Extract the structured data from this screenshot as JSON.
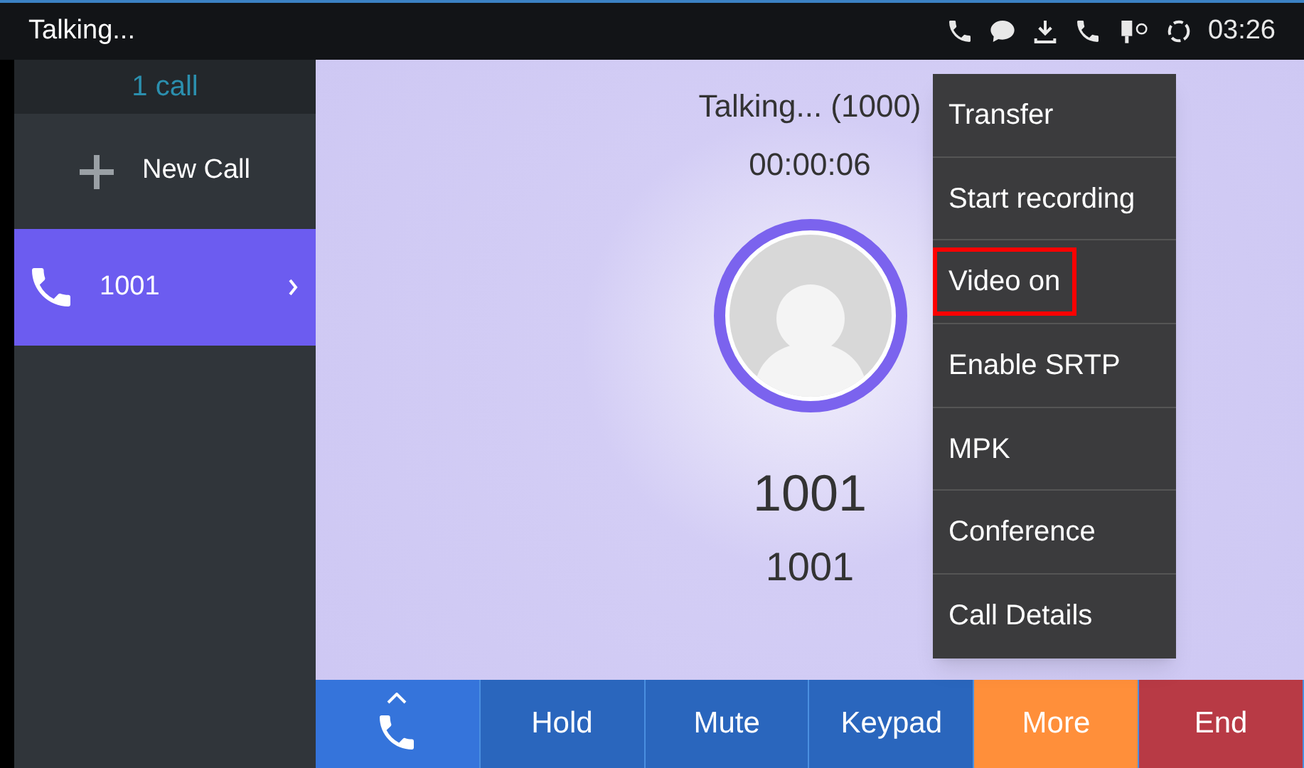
{
  "status_bar": {
    "title": "Talking...",
    "time": "03:26"
  },
  "sidebar": {
    "count": "1 call",
    "new_call": "New Call",
    "calls": [
      {
        "number": "1001",
        "selected": true
      }
    ]
  },
  "call": {
    "status": "Talking... (1000)",
    "duration": "00:00:06",
    "name": "1001",
    "number": "1001"
  },
  "menu": [
    {
      "label": "Transfer",
      "highlighted": false
    },
    {
      "label": "Start recording",
      "highlighted": false
    },
    {
      "label": "Video on",
      "highlighted": true
    },
    {
      "label": "Enable SRTP",
      "highlighted": false
    },
    {
      "label": "MPK",
      "highlighted": false
    },
    {
      "label": "Conference",
      "highlighted": false
    },
    {
      "label": "Call Details",
      "highlighted": false
    }
  ],
  "buttons": [
    {
      "kind": "phone",
      "color": "#3574db"
    },
    {
      "kind": "label",
      "label": "Hold",
      "color": "#2a66bd"
    },
    {
      "kind": "label",
      "label": "Mute",
      "color": "#2a66bd"
    },
    {
      "kind": "label",
      "label": "Keypad",
      "color": "#2a66bd"
    },
    {
      "kind": "label",
      "label": "More",
      "color": "#ff8f3a"
    },
    {
      "kind": "label",
      "label": "End",
      "color": "#b83a45"
    }
  ]
}
